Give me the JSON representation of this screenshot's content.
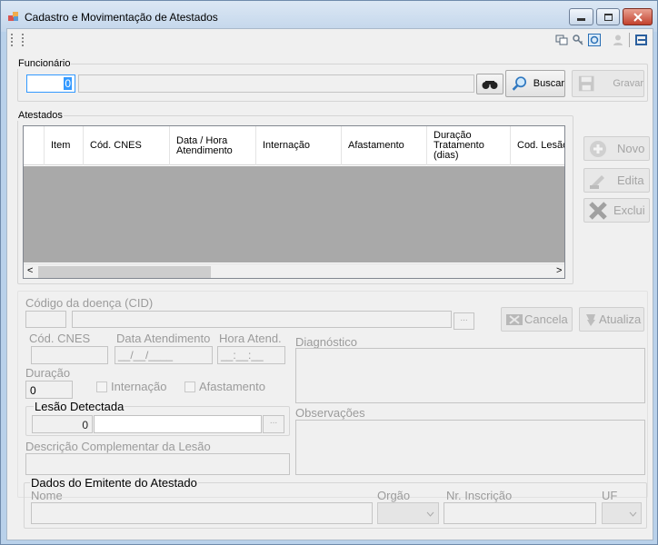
{
  "window": {
    "title": "Cadastro e Movimentação de Atestados"
  },
  "funcionario": {
    "legend": "Funcionário",
    "code": "0",
    "name": "",
    "buscar_label": "Buscar",
    "gravar_label": "Gravar"
  },
  "atestados": {
    "legend": "Atestados",
    "columns": [
      "Item",
      "Cód. CNES",
      "Data / Hora\nAtendimento",
      "Internação",
      "Afastamento",
      "Duração\nTratamento\n(dias)",
      "Cod. Lesão"
    ],
    "novo_label": "Novo",
    "edita_label": "Edita",
    "exclui_label": "Exclui"
  },
  "detail": {
    "cid_label": "Código da doença (CID)",
    "cancela_label": "Cancela",
    "atualiza_label": "Atualiza",
    "cnes_label": "Cód. CNES",
    "data_label": "Data Atendimento",
    "data_value": "__/__/____",
    "hora_label": "Hora Atend.",
    "hora_value": "__:__:__",
    "diagnostico_label": "Diagnóstico",
    "duracao_label": "Duração",
    "duracao_value": "0",
    "internacao_label": "Internação",
    "afastamento_label": "Afastamento",
    "lesao_legend": "Lesão Detectada",
    "lesao_code": "0",
    "observacoes_label": "Observações",
    "descricao_label": "Descrição Complementar da Lesão",
    "ellipsis": "..."
  },
  "emitente": {
    "legend": "Dados do Emitente do Atestado",
    "nome_label": "Nome",
    "orgao_label": "Orgão",
    "inscricao_label": "Nr. Inscrição",
    "uf_label": "UF"
  }
}
